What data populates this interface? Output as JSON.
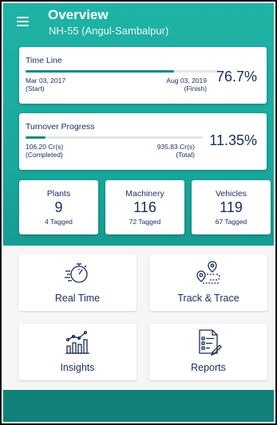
{
  "header": {
    "title": "Overview",
    "subtitle": "NH-55 (Angul-Sambalpur)"
  },
  "timeline": {
    "label": "Time Line",
    "start_date": "Mar 03, 2017",
    "start_caption": "(Start)",
    "finish_date": "Aug 03, 2019",
    "finish_caption": "(Finish)",
    "percent": "76.7%",
    "progress": 0.767
  },
  "turnover": {
    "label": "Turnover Progress",
    "completed_value": "106.20 Cr(s)",
    "completed_caption": "(Completed)",
    "total_value": "935.83 Cr(s)",
    "total_caption": "(Total)",
    "percent": "11.35%",
    "progress": 0.1135
  },
  "stats": [
    {
      "title": "Plants",
      "value": "9",
      "tagged": "4 Tagged"
    },
    {
      "title": "Machinery",
      "value": "116",
      "tagged": "72 Tagged"
    },
    {
      "title": "Vehicles",
      "value": "119",
      "tagged": "67 Tagged"
    }
  ],
  "tiles": [
    {
      "label": "Real Time",
      "icon": "stopwatch-icon"
    },
    {
      "label": "Track & Trace",
      "icon": "location-route-icon"
    },
    {
      "label": "Insights",
      "icon": "chart-icon"
    },
    {
      "label": "Reports",
      "icon": "report-document-icon"
    }
  ],
  "colors": {
    "accent": "#1aa79c",
    "dark_teal": "#118179",
    "text_navy": "#1a2b5e",
    "progress_fill": "#128b82"
  }
}
